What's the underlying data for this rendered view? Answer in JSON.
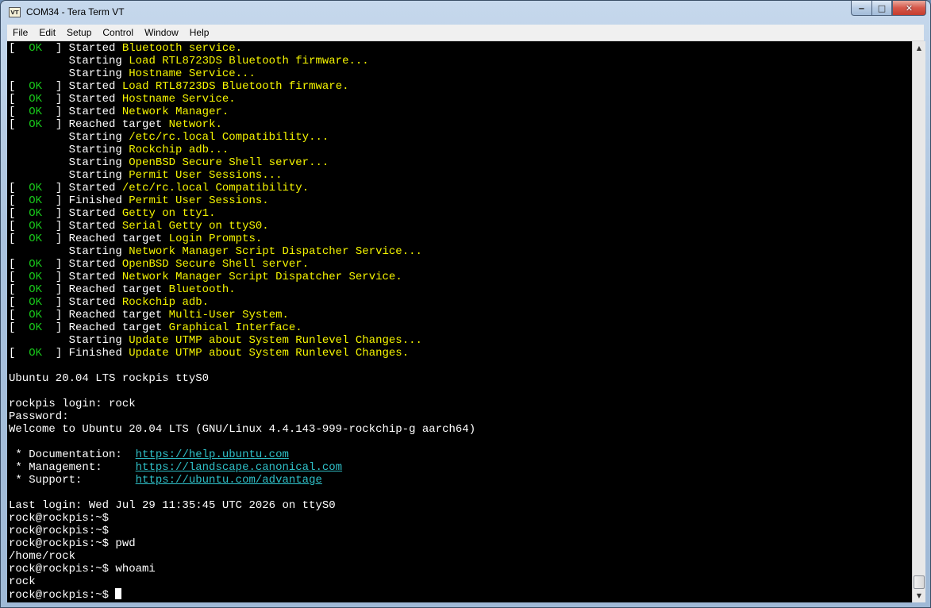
{
  "window": {
    "title": "COM34 - Tera Term VT",
    "icon": "VT",
    "minimize_glyph": "‒",
    "maximize_glyph": "□",
    "close_glyph": "✕"
  },
  "menu": [
    "File",
    "Edit",
    "Setup",
    "Control",
    "Window",
    "Help"
  ],
  "colors": {
    "ok": "#18c81a",
    "highlight": "#f5f500",
    "link": "#2fc0c8",
    "text": "#ffffff",
    "background": "#000000"
  },
  "terminal": {
    "lines": [
      [
        [
          "[  "
        ],
        [
          "OK",
          "ok"
        ],
        [
          "  ] Started "
        ],
        [
          "Bluetooth service.",
          "hl"
        ]
      ],
      [
        [
          "         Starting "
        ],
        [
          "Load RTL8723DS Bluetooth firmware...",
          "hl"
        ]
      ],
      [
        [
          "         Starting "
        ],
        [
          "Hostname Service...",
          "hl"
        ]
      ],
      [
        [
          "[  "
        ],
        [
          "OK",
          "ok"
        ],
        [
          "  ] Started "
        ],
        [
          "Load RTL8723DS Bluetooth firmware.",
          "hl"
        ]
      ],
      [
        [
          "[  "
        ],
        [
          "OK",
          "ok"
        ],
        [
          "  ] Started "
        ],
        [
          "Hostname Service.",
          "hl"
        ]
      ],
      [
        [
          "[  "
        ],
        [
          "OK",
          "ok"
        ],
        [
          "  ] Started "
        ],
        [
          "Network Manager.",
          "hl"
        ]
      ],
      [
        [
          "[  "
        ],
        [
          "OK",
          "ok"
        ],
        [
          "  ] Reached target "
        ],
        [
          "Network.",
          "hl"
        ]
      ],
      [
        [
          "         Starting "
        ],
        [
          "/etc/rc.local Compatibility...",
          "hl"
        ]
      ],
      [
        [
          "         Starting "
        ],
        [
          "Rockchip adb...",
          "hl"
        ]
      ],
      [
        [
          "         Starting "
        ],
        [
          "OpenBSD Secure Shell server...",
          "hl"
        ]
      ],
      [
        [
          "         Starting "
        ],
        [
          "Permit User Sessions...",
          "hl"
        ]
      ],
      [
        [
          "[  "
        ],
        [
          "OK",
          "ok"
        ],
        [
          "  ] Started "
        ],
        [
          "/etc/rc.local Compatibility.",
          "hl"
        ]
      ],
      [
        [
          "[  "
        ],
        [
          "OK",
          "ok"
        ],
        [
          "  ] Finished "
        ],
        [
          "Permit User Sessions.",
          "hl"
        ]
      ],
      [
        [
          "[  "
        ],
        [
          "OK",
          "ok"
        ],
        [
          "  ] Started "
        ],
        [
          "Getty on tty1.",
          "hl"
        ]
      ],
      [
        [
          "[  "
        ],
        [
          "OK",
          "ok"
        ],
        [
          "  ] Started "
        ],
        [
          "Serial Getty on ttyS0.",
          "hl"
        ]
      ],
      [
        [
          "[  "
        ],
        [
          "OK",
          "ok"
        ],
        [
          "  ] Reached target "
        ],
        [
          "Login Prompts.",
          "hl"
        ]
      ],
      [
        [
          "         Starting "
        ],
        [
          "Network Manager Script Dispatcher Service...",
          "hl"
        ]
      ],
      [
        [
          "[  "
        ],
        [
          "OK",
          "ok"
        ],
        [
          "  ] Started "
        ],
        [
          "OpenBSD Secure Shell server.",
          "hl"
        ]
      ],
      [
        [
          "[  "
        ],
        [
          "OK",
          "ok"
        ],
        [
          "  ] Started "
        ],
        [
          "Network Manager Script Dispatcher Service.",
          "hl"
        ]
      ],
      [
        [
          "[  "
        ],
        [
          "OK",
          "ok"
        ],
        [
          "  ] Reached target "
        ],
        [
          "Bluetooth.",
          "hl"
        ]
      ],
      [
        [
          "[  "
        ],
        [
          "OK",
          "ok"
        ],
        [
          "  ] Started "
        ],
        [
          "Rockchip adb.",
          "hl"
        ]
      ],
      [
        [
          "[  "
        ],
        [
          "OK",
          "ok"
        ],
        [
          "  ] Reached target "
        ],
        [
          "Multi-User System.",
          "hl"
        ]
      ],
      [
        [
          "[  "
        ],
        [
          "OK",
          "ok"
        ],
        [
          "  ] Reached target "
        ],
        [
          "Graphical Interface.",
          "hl"
        ]
      ],
      [
        [
          "         Starting "
        ],
        [
          "Update UTMP about System Runlevel Changes...",
          "hl"
        ]
      ],
      [
        [
          "[  "
        ],
        [
          "OK",
          "ok"
        ],
        [
          "  ] Finished "
        ],
        [
          "Update UTMP about System Runlevel Changes.",
          "hl"
        ]
      ],
      [],
      [
        [
          "Ubuntu 20.04 LTS rockpis ttyS0"
        ]
      ],
      [],
      [
        [
          "rockpis login: rock"
        ]
      ],
      [
        [
          "Password:"
        ]
      ],
      [
        [
          "Welcome to Ubuntu 20.04 LTS (GNU/Linux 4.4.143-999-rockchip-g aarch64)"
        ]
      ],
      [],
      [
        [
          " * Documentation:  "
        ],
        [
          "https://help.ubuntu.com",
          "link"
        ]
      ],
      [
        [
          " * Management:     "
        ],
        [
          "https://landscape.canonical.com",
          "link"
        ]
      ],
      [
        [
          " * Support:        "
        ],
        [
          "https://ubuntu.com/advantage",
          "link"
        ]
      ],
      [],
      [
        [
          "Last login: Wed Jul 29 11:35:45 UTC 2026 on ttyS0"
        ]
      ],
      [
        [
          "rock@rockpis:~$"
        ]
      ],
      [
        [
          "rock@rockpis:~$"
        ]
      ],
      [
        [
          "rock@rockpis:~$ pwd"
        ]
      ],
      [
        [
          "/home/rock"
        ]
      ],
      [
        [
          "rock@rockpis:~$ whoami"
        ]
      ],
      [
        [
          "rock"
        ]
      ],
      [
        [
          "rock@rockpis:~$ "
        ],
        [
          "",
          "cursor"
        ]
      ]
    ]
  },
  "scrollbar": {
    "up_glyph": "▲",
    "down_glyph": "▼",
    "position": 1.0
  }
}
